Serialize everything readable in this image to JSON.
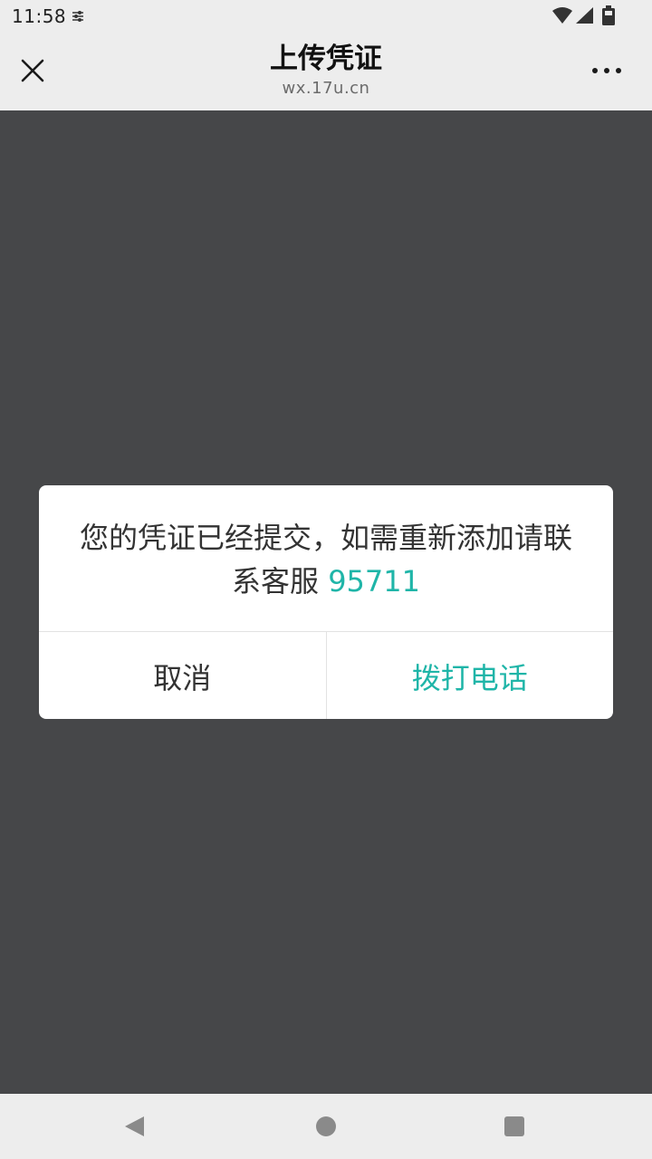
{
  "status_bar": {
    "time": "11:58",
    "icons": [
      "notification-settings-icon",
      "wifi-icon",
      "signal-icon",
      "battery-icon"
    ]
  },
  "title_bar": {
    "title": "上传凭证",
    "domain": "wx.17u.cn",
    "close_icon": "close-icon",
    "more_icon": "more-icon"
  },
  "dialog": {
    "message": "您的凭证已经提交，如需重新添加请联系客服",
    "phone": "95711",
    "cancel_label": "取消",
    "call_label": "拨打电话",
    "accent_color": "#1fb5a8"
  },
  "nav_bar": {
    "icons": [
      "back-icon",
      "home-icon",
      "recents-icon"
    ]
  },
  "colors": {
    "overlay": "#464749",
    "bar_background": "#ededed",
    "accent": "#1fb5a8"
  }
}
